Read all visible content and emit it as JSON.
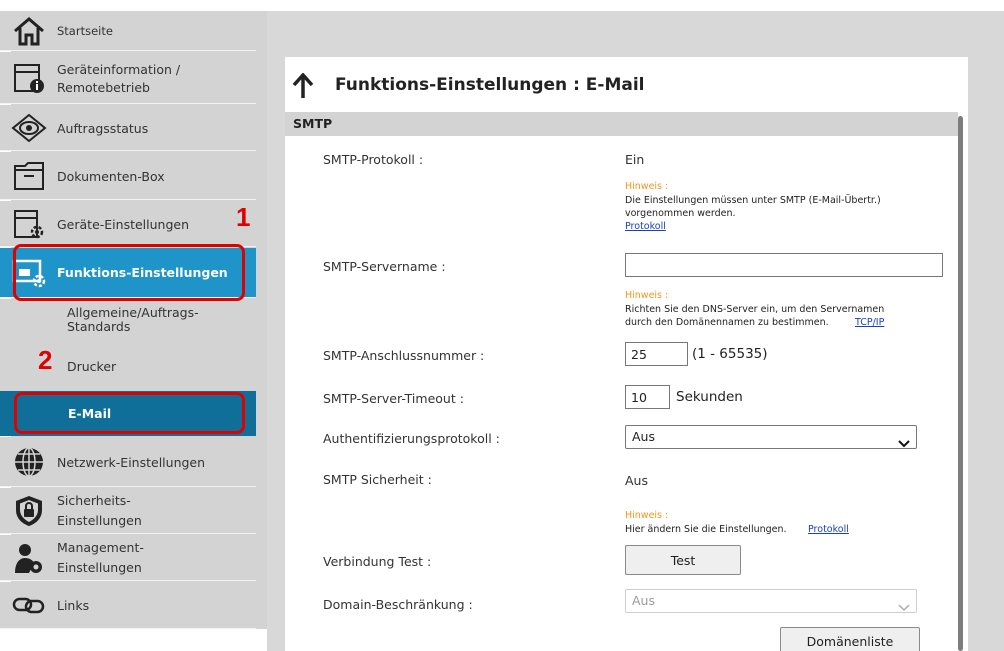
{
  "sidebar": {
    "items": [
      {
        "label": "Startseite",
        "icon": "home-icon"
      },
      {
        "label": "Geräteinformation /",
        "label2": "Remotebetrieb",
        "icon": "device-info-icon"
      },
      {
        "label": "Auftragsstatus",
        "icon": "eye-icon"
      },
      {
        "label": "Dokumenten-Box",
        "icon": "folder-icon"
      },
      {
        "label": "Geräte-Einstellungen",
        "icon": "device-settings-icon"
      },
      {
        "label": "Funktions-Einstellungen",
        "icon": "function-settings-icon"
      },
      {
        "label": "Netzwerk-Einstellungen",
        "icon": "globe-icon"
      },
      {
        "label": "Sicherheits-",
        "label2": "Einstellungen",
        "icon": "shield-lock-icon"
      },
      {
        "label": "Management-",
        "label2": "Einstellungen",
        "icon": "user-gear-icon"
      },
      {
        "label": "Links",
        "icon": "link-icon"
      }
    ],
    "subitems": [
      {
        "label": "Allgemeine/Auftrags-",
        "label2": "Standards"
      },
      {
        "label": "Drucker"
      },
      {
        "label": "E-Mail"
      }
    ]
  },
  "callouts": {
    "one": "1",
    "two": "2"
  },
  "page": {
    "title": "Funktions-Einstellungen : E-Mail"
  },
  "section": {
    "title": "SMTP"
  },
  "fields": {
    "smtp_protocol": {
      "label": "SMTP-Protokoll :",
      "value": "Ein",
      "hint_title": "Hinweis :",
      "hint_text": "Die Einstellungen müssen unter SMTP (E-Mail-Übertr.) vorgenommen werden.",
      "hint_link": "Protokoll"
    },
    "server_name": {
      "label": "SMTP-Servername :",
      "value": "",
      "hint_title": "Hinweis :",
      "hint_text": "Richten Sie den DNS-Server ein, um den Servernamen durch den Domänennamen zu bestimmen.",
      "hint_link": "TCP/IP"
    },
    "port": {
      "label": "SMTP-Anschlussnummer :",
      "value": "25",
      "unit": "(1 - 65535)"
    },
    "timeout": {
      "label": "SMTP-Server-Timeout :",
      "value": "10",
      "unit": "Sekunden"
    },
    "auth": {
      "label": "Authentifizierungsprotokoll :",
      "value": "Aus"
    },
    "security": {
      "label": "SMTP Sicherheit :",
      "value": "Aus",
      "hint_title": "Hinweis :",
      "hint_text": "Hier ändern Sie die Einstellungen.",
      "hint_link": "Protokoll"
    },
    "connection_test": {
      "label": "Verbindung Test :",
      "button": "Test"
    },
    "domain_restriction": {
      "label": "Domain-Beschränkung :",
      "value": "Aus",
      "button": "Domänenliste"
    }
  },
  "colors": {
    "accent": "#1f94c8",
    "accent_dark": "#0f6f99",
    "callout": "#e00000",
    "hint": "#f7941d",
    "link": "#1a3fbf"
  }
}
